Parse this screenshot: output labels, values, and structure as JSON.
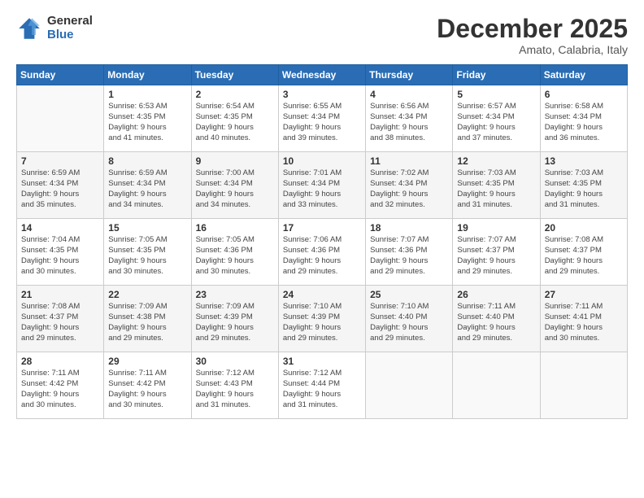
{
  "header": {
    "logo_general": "General",
    "logo_blue": "Blue",
    "month_title": "December 2025",
    "subtitle": "Amato, Calabria, Italy"
  },
  "days_of_week": [
    "Sunday",
    "Monday",
    "Tuesday",
    "Wednesday",
    "Thursday",
    "Friday",
    "Saturday"
  ],
  "weeks": [
    [
      {
        "day": "",
        "info": ""
      },
      {
        "day": "1",
        "info": "Sunrise: 6:53 AM\nSunset: 4:35 PM\nDaylight: 9 hours\nand 41 minutes."
      },
      {
        "day": "2",
        "info": "Sunrise: 6:54 AM\nSunset: 4:35 PM\nDaylight: 9 hours\nand 40 minutes."
      },
      {
        "day": "3",
        "info": "Sunrise: 6:55 AM\nSunset: 4:34 PM\nDaylight: 9 hours\nand 39 minutes."
      },
      {
        "day": "4",
        "info": "Sunrise: 6:56 AM\nSunset: 4:34 PM\nDaylight: 9 hours\nand 38 minutes."
      },
      {
        "day": "5",
        "info": "Sunrise: 6:57 AM\nSunset: 4:34 PM\nDaylight: 9 hours\nand 37 minutes."
      },
      {
        "day": "6",
        "info": "Sunrise: 6:58 AM\nSunset: 4:34 PM\nDaylight: 9 hours\nand 36 minutes."
      }
    ],
    [
      {
        "day": "7",
        "info": "Sunrise: 6:59 AM\nSunset: 4:34 PM\nDaylight: 9 hours\nand 35 minutes."
      },
      {
        "day": "8",
        "info": "Sunrise: 6:59 AM\nSunset: 4:34 PM\nDaylight: 9 hours\nand 34 minutes."
      },
      {
        "day": "9",
        "info": "Sunrise: 7:00 AM\nSunset: 4:34 PM\nDaylight: 9 hours\nand 34 minutes."
      },
      {
        "day": "10",
        "info": "Sunrise: 7:01 AM\nSunset: 4:34 PM\nDaylight: 9 hours\nand 33 minutes."
      },
      {
        "day": "11",
        "info": "Sunrise: 7:02 AM\nSunset: 4:34 PM\nDaylight: 9 hours\nand 32 minutes."
      },
      {
        "day": "12",
        "info": "Sunrise: 7:03 AM\nSunset: 4:35 PM\nDaylight: 9 hours\nand 31 minutes."
      },
      {
        "day": "13",
        "info": "Sunrise: 7:03 AM\nSunset: 4:35 PM\nDaylight: 9 hours\nand 31 minutes."
      }
    ],
    [
      {
        "day": "14",
        "info": "Sunrise: 7:04 AM\nSunset: 4:35 PM\nDaylight: 9 hours\nand 30 minutes."
      },
      {
        "day": "15",
        "info": "Sunrise: 7:05 AM\nSunset: 4:35 PM\nDaylight: 9 hours\nand 30 minutes."
      },
      {
        "day": "16",
        "info": "Sunrise: 7:05 AM\nSunset: 4:36 PM\nDaylight: 9 hours\nand 30 minutes."
      },
      {
        "day": "17",
        "info": "Sunrise: 7:06 AM\nSunset: 4:36 PM\nDaylight: 9 hours\nand 29 minutes."
      },
      {
        "day": "18",
        "info": "Sunrise: 7:07 AM\nSunset: 4:36 PM\nDaylight: 9 hours\nand 29 minutes."
      },
      {
        "day": "19",
        "info": "Sunrise: 7:07 AM\nSunset: 4:37 PM\nDaylight: 9 hours\nand 29 minutes."
      },
      {
        "day": "20",
        "info": "Sunrise: 7:08 AM\nSunset: 4:37 PM\nDaylight: 9 hours\nand 29 minutes."
      }
    ],
    [
      {
        "day": "21",
        "info": "Sunrise: 7:08 AM\nSunset: 4:37 PM\nDaylight: 9 hours\nand 29 minutes."
      },
      {
        "day": "22",
        "info": "Sunrise: 7:09 AM\nSunset: 4:38 PM\nDaylight: 9 hours\nand 29 minutes."
      },
      {
        "day": "23",
        "info": "Sunrise: 7:09 AM\nSunset: 4:39 PM\nDaylight: 9 hours\nand 29 minutes."
      },
      {
        "day": "24",
        "info": "Sunrise: 7:10 AM\nSunset: 4:39 PM\nDaylight: 9 hours\nand 29 minutes."
      },
      {
        "day": "25",
        "info": "Sunrise: 7:10 AM\nSunset: 4:40 PM\nDaylight: 9 hours\nand 29 minutes."
      },
      {
        "day": "26",
        "info": "Sunrise: 7:11 AM\nSunset: 4:40 PM\nDaylight: 9 hours\nand 29 minutes."
      },
      {
        "day": "27",
        "info": "Sunrise: 7:11 AM\nSunset: 4:41 PM\nDaylight: 9 hours\nand 30 minutes."
      }
    ],
    [
      {
        "day": "28",
        "info": "Sunrise: 7:11 AM\nSunset: 4:42 PM\nDaylight: 9 hours\nand 30 minutes."
      },
      {
        "day": "29",
        "info": "Sunrise: 7:11 AM\nSunset: 4:42 PM\nDaylight: 9 hours\nand 30 minutes."
      },
      {
        "day": "30",
        "info": "Sunrise: 7:12 AM\nSunset: 4:43 PM\nDaylight: 9 hours\nand 31 minutes."
      },
      {
        "day": "31",
        "info": "Sunrise: 7:12 AM\nSunset: 4:44 PM\nDaylight: 9 hours\nand 31 minutes."
      },
      {
        "day": "",
        "info": ""
      },
      {
        "day": "",
        "info": ""
      },
      {
        "day": "",
        "info": ""
      }
    ]
  ]
}
